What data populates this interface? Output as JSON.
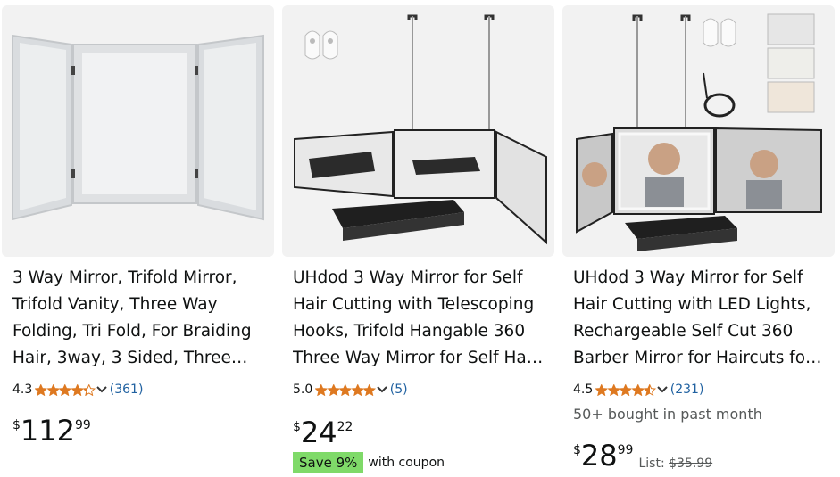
{
  "products": [
    {
      "title_lines": [
        "3 Way Mirror, Trifold Mirror,",
        "Trifold Vanity, Three Way",
        "Folding, Tri Fold, For Braiding",
        "Hair, 3way, 3 Sided, Three…"
      ],
      "rating": "4.3",
      "stars": 4.3,
      "review_count": "(361)",
      "price_symbol": "$",
      "price_whole": "112",
      "price_fraction": "99"
    },
    {
      "title_lines": [
        "UHdod 3 Way Mirror for Self",
        "Hair Cutting with Telescoping",
        "Hooks, Trifold Hangable 360",
        "Three Way Mirror for Self Ha…"
      ],
      "rating": "5.0",
      "stars": 5.0,
      "review_count": "(5)",
      "price_symbol": "$",
      "price_whole": "24",
      "price_fraction": "22",
      "coupon_badge": "Save 9%",
      "coupon_text": "with coupon"
    },
    {
      "title_lines": [
        "UHdod 3 Way Mirror for Self",
        "Hair Cutting with LED Lights,",
        "Rechargeable Self Cut 360",
        "Barber Mirror for Haircuts fo…"
      ],
      "rating": "4.5",
      "stars": 4.5,
      "review_count": "(231)",
      "bought": "50+ bought in past month",
      "price_symbol": "$",
      "price_whole": "28",
      "price_fraction": "99",
      "list_label": "List:",
      "list_price": "$35.99"
    }
  ],
  "colors": {
    "star": "#de7921",
    "link": "#2162a1",
    "coupon_badge": "#7fda69",
    "image_bg": "#f2f2f2"
  },
  "icons": {
    "star": "star-icon",
    "rating_dropdown": "chevron-down-icon"
  }
}
